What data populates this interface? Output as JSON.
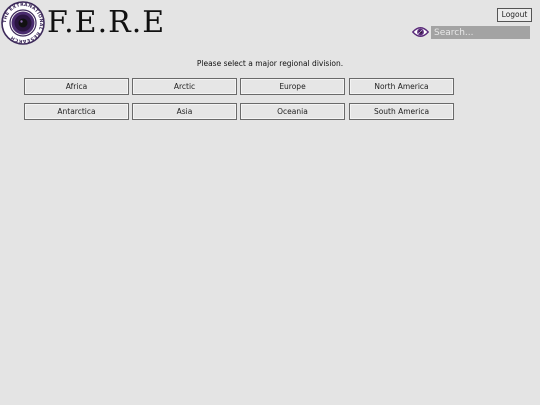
{
  "header": {
    "brand": "F.E.R.E",
    "logout_label": "Logout",
    "search_placeholder": "Search...",
    "seal_text": "THE EXTRANATIONAL RESEARCH",
    "colors": {
      "seal_purple": "#4a2c6e",
      "eye_purple": "#5a2a7a",
      "search_bg": "#a3a3a3"
    },
    "icons": {
      "seal": "organization-seal-icon",
      "eye": "eye-icon"
    }
  },
  "main": {
    "prompt": "Please select a major regional division.",
    "regions": [
      {
        "label": "Africa"
      },
      {
        "label": "Arctic"
      },
      {
        "label": "Europe"
      },
      {
        "label": "North America"
      },
      {
        "label": "Antarctica"
      },
      {
        "label": "Asia"
      },
      {
        "label": "Oceania"
      },
      {
        "label": "South America"
      }
    ]
  }
}
